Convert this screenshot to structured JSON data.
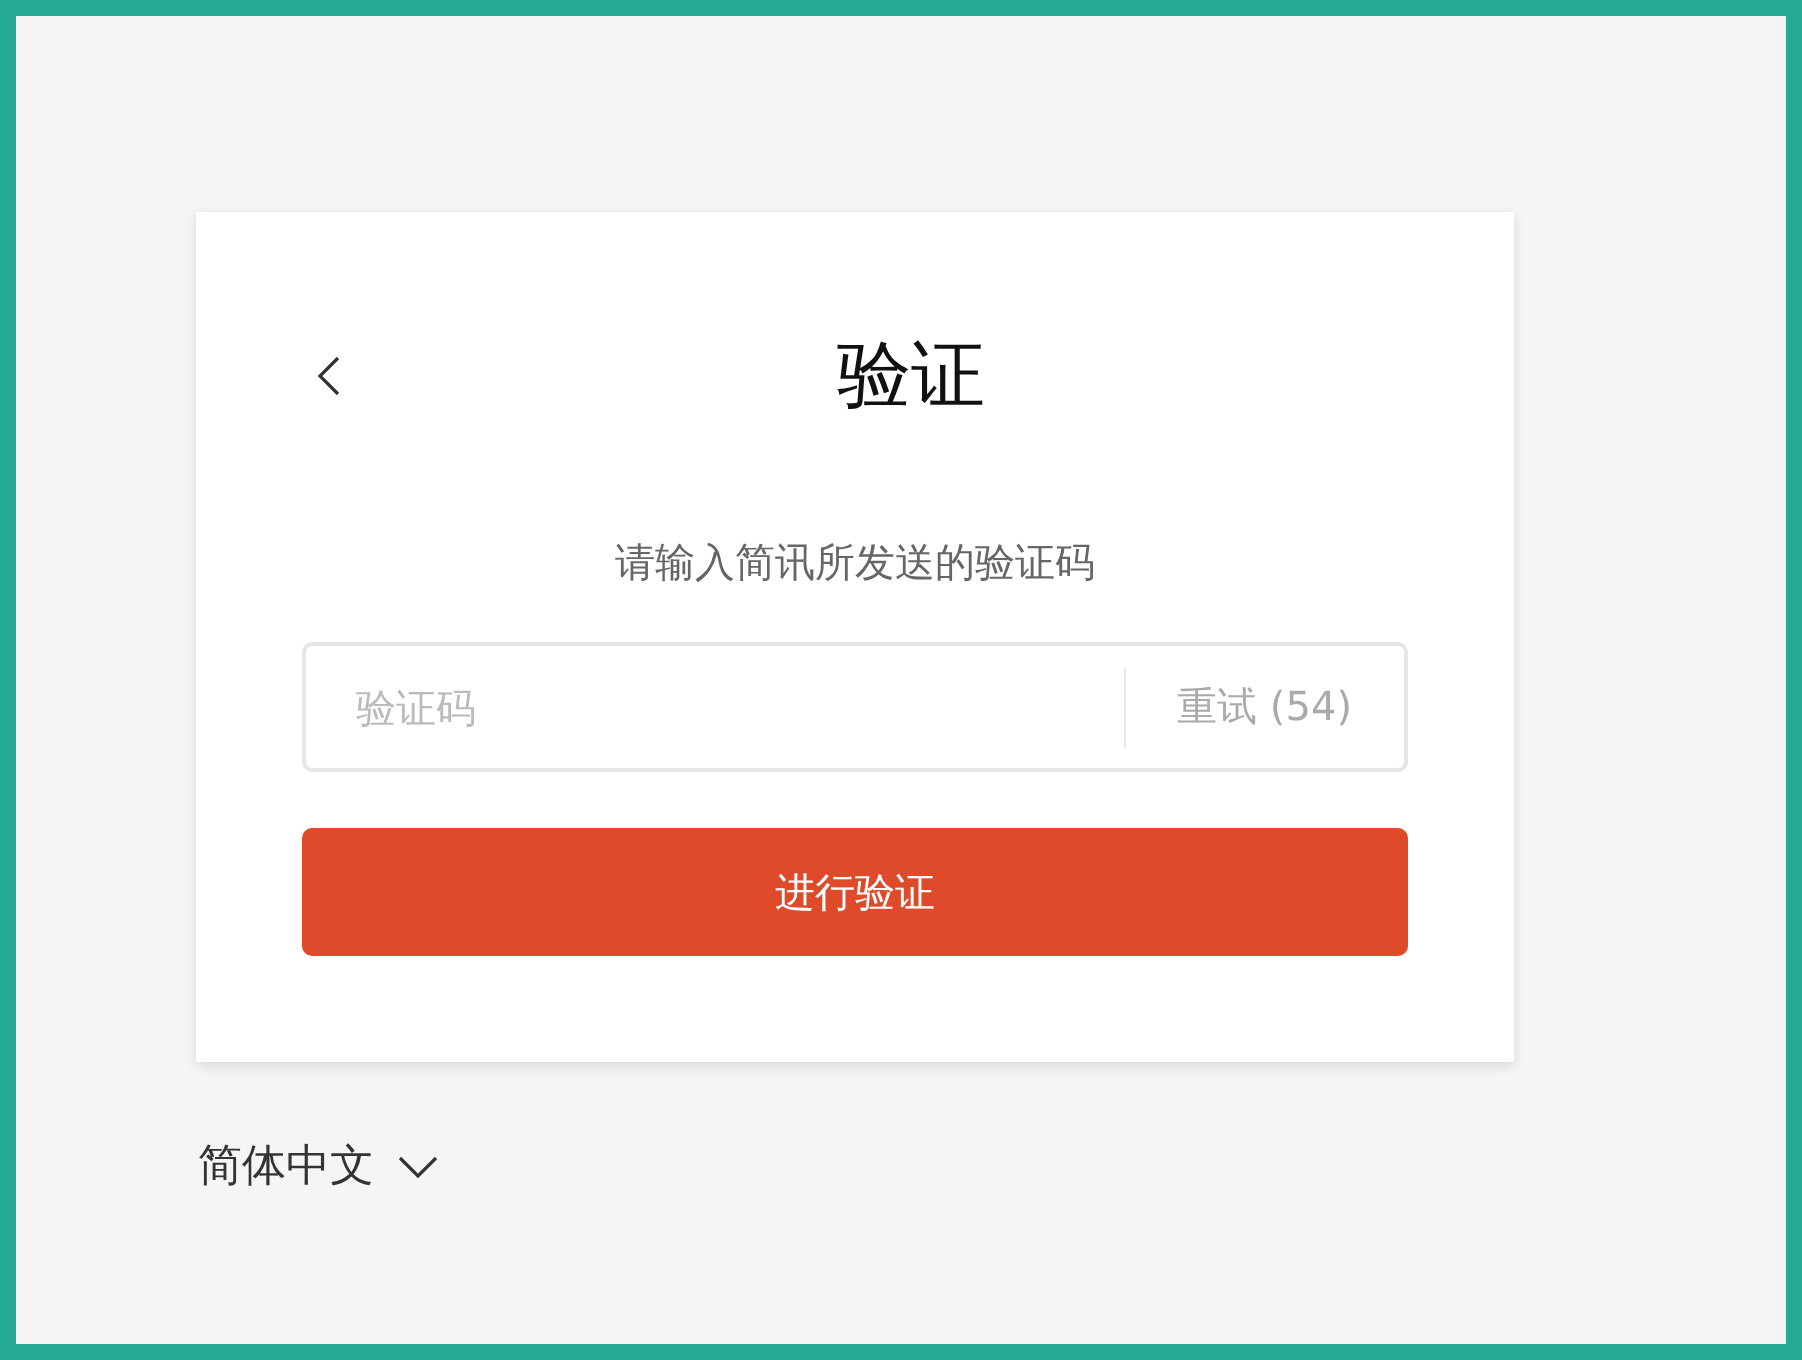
{
  "header": {
    "title": "验证"
  },
  "prompt": "请输入简讯所发送的验证码",
  "code_field": {
    "placeholder": "验证码",
    "resend": {
      "label": "重试 (54)",
      "disabled": true
    }
  },
  "submit_button": {
    "label": "进行验证"
  },
  "language_selector": {
    "label": "简体中文"
  }
}
